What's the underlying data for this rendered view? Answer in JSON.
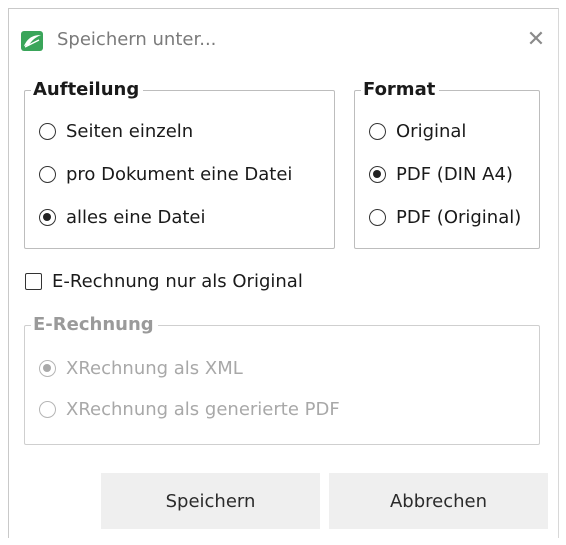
{
  "window": {
    "title": "Speichern unter...",
    "app_icon": "app-logo-icon",
    "close_icon": "close-icon",
    "close_glyph": "✕"
  },
  "aufteilung": {
    "legend": "Aufteilung",
    "options": [
      {
        "label": "Seiten einzeln",
        "checked": false
      },
      {
        "label": "pro Dokument eine Datei",
        "checked": false
      },
      {
        "label": "alles eine Datei",
        "checked": true
      }
    ]
  },
  "format": {
    "legend": "Format",
    "options": [
      {
        "label": "Original",
        "checked": false
      },
      {
        "label": "PDF (DIN A4)",
        "checked": true
      },
      {
        "label": "PDF (Original)",
        "checked": false
      }
    ]
  },
  "erechnung_checkbox": {
    "label": "E-Rechnung nur als Original",
    "checked": false
  },
  "erechnung": {
    "legend": "E-Rechnung",
    "disabled": true,
    "options": [
      {
        "label": "XRechnung als XML",
        "checked": true
      },
      {
        "label": "XRechnung als generierte PDF",
        "checked": false
      }
    ]
  },
  "buttons": {
    "save_label": "Speichern",
    "cancel_label": "Abbrechen"
  },
  "colors": {
    "accent_icon": "#3aa55a",
    "disabled_text": "#a8a8a8",
    "button_bg": "#efefef"
  }
}
